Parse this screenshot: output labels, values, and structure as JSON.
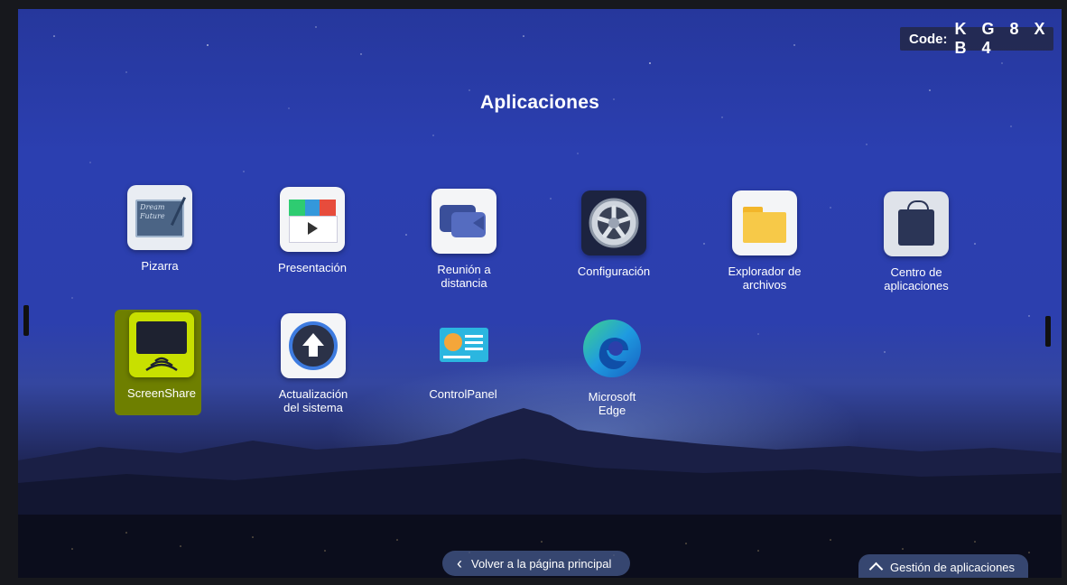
{
  "page_title": "Aplicaciones",
  "code": {
    "label": "Code:",
    "value": "K G 8 X B 4"
  },
  "apps": [
    {
      "label": "Pizarra",
      "icon": "whiteboard-icon"
    },
    {
      "label": "Presentación",
      "icon": "presentation-icon"
    },
    {
      "label_line1": "Reunión a",
      "label_line2": "distancia",
      "icon": "video-meeting-icon"
    },
    {
      "label": "Configuración",
      "icon": "settings-wheel-icon"
    },
    {
      "label_line1": "Explorador de",
      "label_line2": "archivos",
      "icon": "folder-icon"
    },
    {
      "label_line1": "Centro de",
      "label_line2": "aplicaciones",
      "icon": "shopping-bag-icon"
    },
    {
      "label": "ScreenShare",
      "icon": "screenshare-icon",
      "highlight_color": "#c8e000"
    },
    {
      "label_line1": "Actualización",
      "label_line2": "del sistema",
      "icon": "system-update-icon"
    },
    {
      "label": "ControlPanel",
      "icon": "control-panel-icon"
    },
    {
      "label_line1": "Microsoft",
      "label_line2": "Edge",
      "icon": "edge-icon"
    }
  ],
  "back_button": {
    "label": "Volver a la página principal",
    "icon": "chevron-left-icon"
  },
  "manage_button": {
    "label": "Gestión de aplicaciones",
    "icon": "chevron-up-icon"
  },
  "whiteboard_art": {
    "line1": "Dream",
    "line2": "Future"
  },
  "colors": {
    "highlight": "#c8e000",
    "sky_top": "#26379c"
  }
}
